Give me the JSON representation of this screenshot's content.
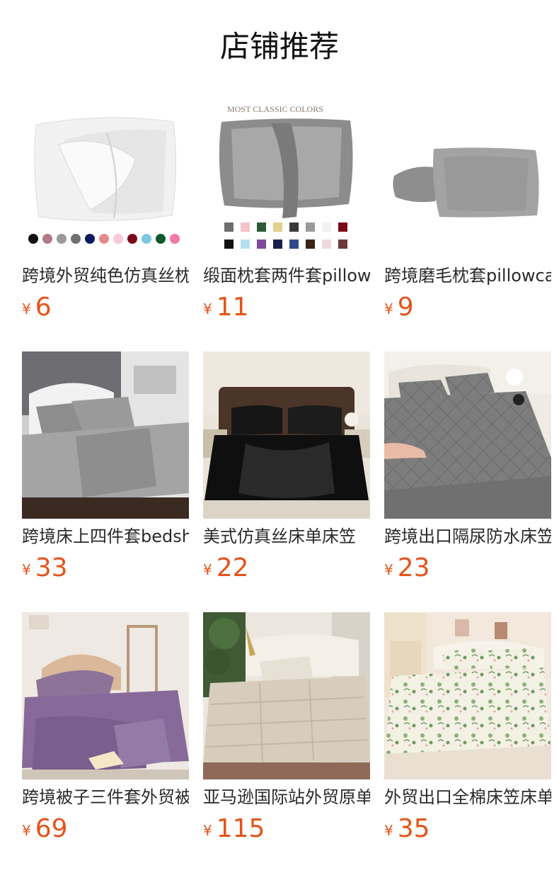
{
  "page": {
    "title": "店铺推荐"
  },
  "currency_symbol": "¥",
  "accent_color": "#e5531a",
  "products": [
    {
      "name": "跨境外贸纯色仿真丝枕套",
      "price": "6"
    },
    {
      "name": "缎面枕套两件套pillowcase",
      "price": "11",
      "image_caption": "MOST CLASSIC COLORS"
    },
    {
      "name": "跨境磨毛枕套pillowcase",
      "price": "9"
    },
    {
      "name": "跨境床上四件套bedsheet",
      "price": "33"
    },
    {
      "name": "美式仿真丝床单床笠",
      "price": "22"
    },
    {
      "name": "跨境出口隔尿防水床笠",
      "price": "23"
    },
    {
      "name": "跨境被子三件套外贸被",
      "price": "69"
    },
    {
      "name": "亚马逊国际站外贸原单被",
      "price": "115"
    },
    {
      "name": "外贸出口全棉床笠床单",
      "price": "35"
    }
  ]
}
